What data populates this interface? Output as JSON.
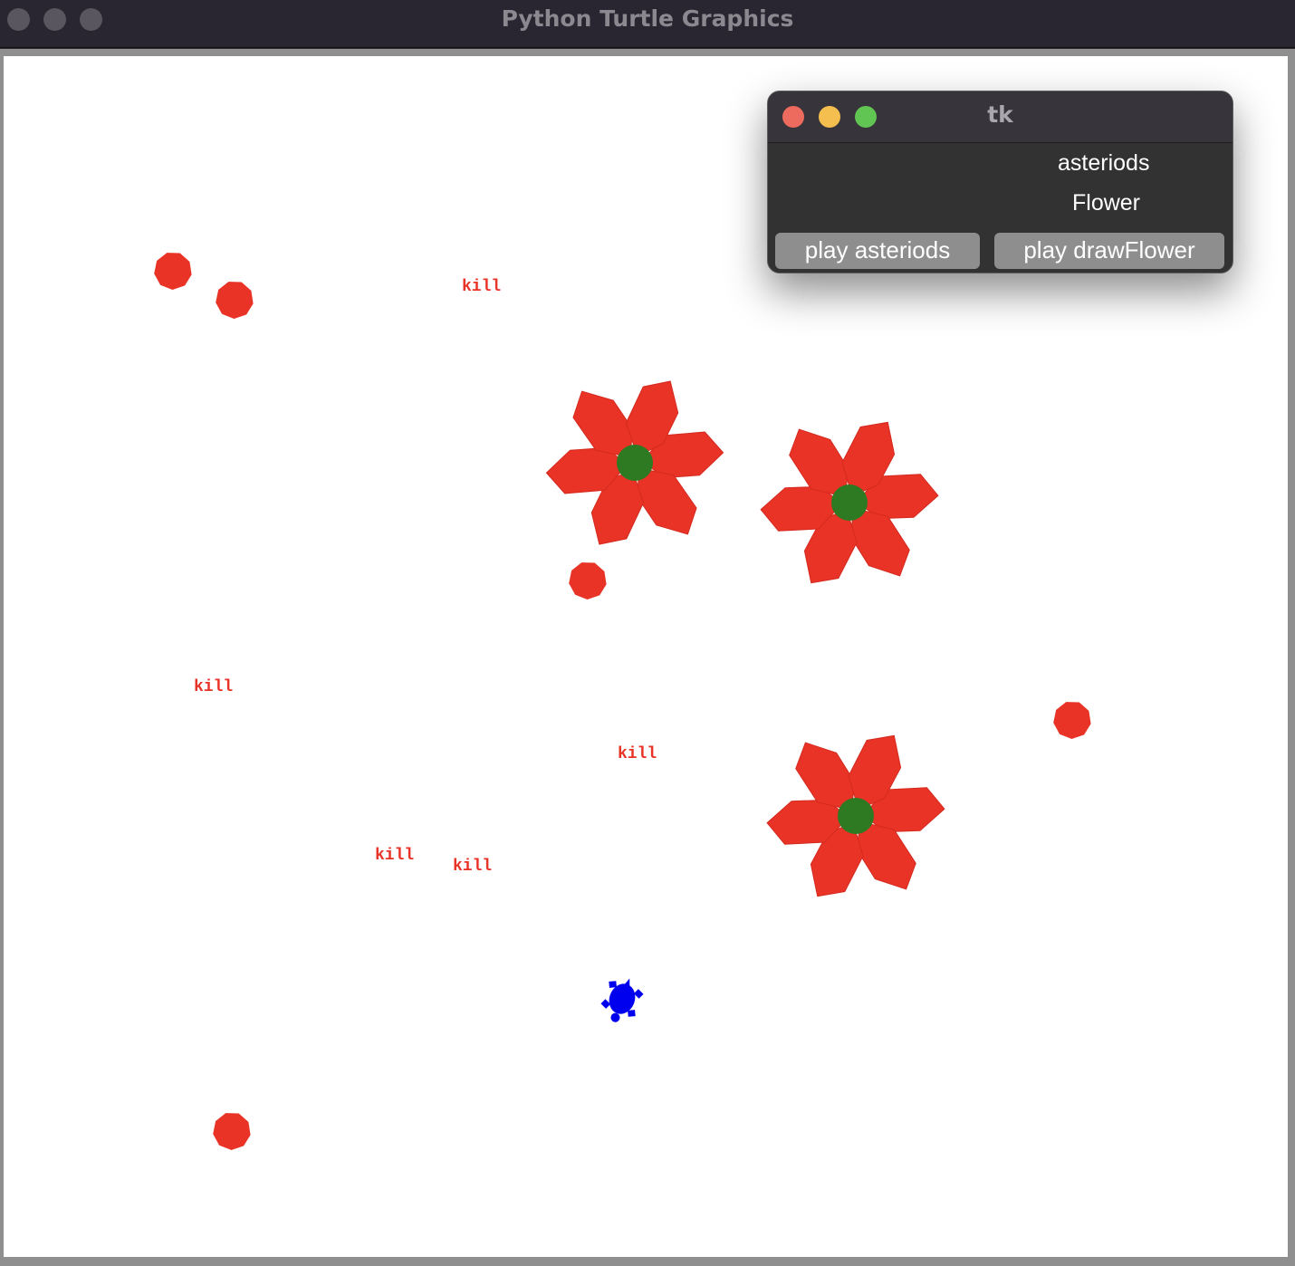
{
  "main_window": {
    "title": "Python Turtle Graphics"
  },
  "canvas": {
    "kill_label": "kill",
    "kill_labels": [
      "kill",
      "kill",
      "kill",
      "kill",
      "kill"
    ],
    "asteroid_color": "#e83326",
    "petal_color": "#e83326",
    "flower_center_color": "#2e7a22",
    "turtle_color": "#0000ee",
    "background": "#ffffff"
  },
  "tk_window": {
    "title": "tk",
    "label_asteroids": "asteriods",
    "label_flower": "Flower",
    "button_asteroids": "play asteriods",
    "button_flower": "play drawFlower"
  }
}
